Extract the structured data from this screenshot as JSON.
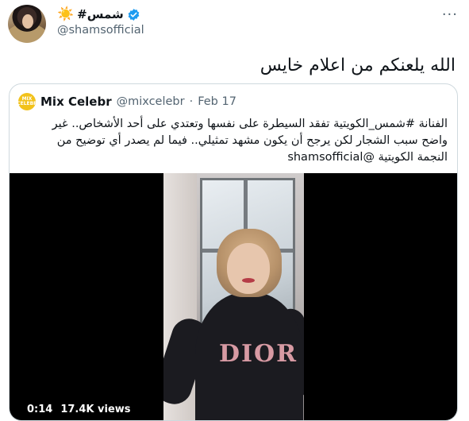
{
  "tweet": {
    "author": {
      "display_name": "#شمس",
      "sun_glyph": "☀️",
      "handle": "@shamsofficial",
      "verified": true
    },
    "more_glyph": "···",
    "text": "الله يلعنكم من اعلام خايس"
  },
  "quote": {
    "avatar_label": "MIX\nCELEBR",
    "name": "Mix Celebr",
    "handle": "@mixcelebr",
    "separator": "·",
    "date": "Feb 17",
    "lines": [
      "الفنانة #شمس_الكويتية تفقد السيطرة على نفسها وتعتدي على أحد الأشخاص.. غير",
      "واضح سبب الشجار لكن يرجح أن يكون مشهد تمثيلي.. فيما لم يصدر أي توضيح من",
      "النجمة الكويتية @shamsofficial"
    ],
    "video": {
      "time": "0:14",
      "views": "17.4K views",
      "shirt_logo": "DIOR"
    }
  },
  "colors": {
    "text_primary": "#0f1419",
    "text_secondary": "#536471",
    "verified_blue": "#1d9bf0",
    "border": "#cfd9de",
    "sun": "#f5a623",
    "mix_logo": "#f2c21b"
  }
}
